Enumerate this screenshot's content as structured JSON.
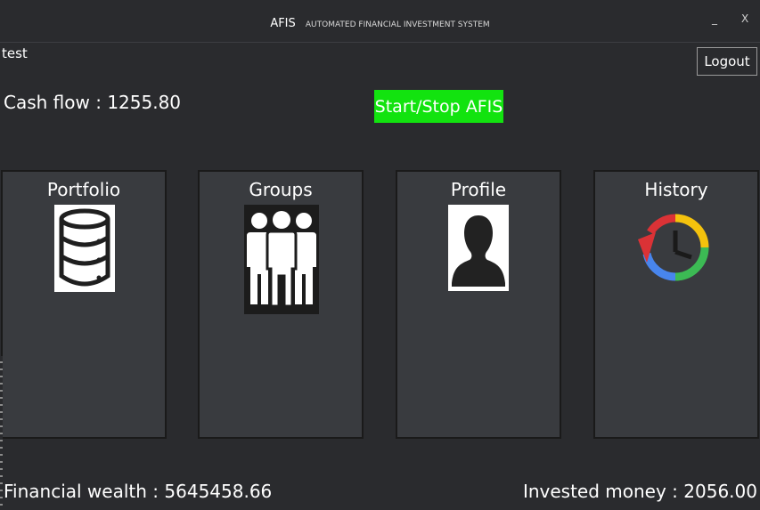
{
  "window": {
    "app_name": "AFIS",
    "app_subtitle": "AUTOMATED FINANCIAL INVESTMENT SYSTEM",
    "minimize": "_",
    "close": "X"
  },
  "user": {
    "name": "test"
  },
  "logout_label": "Logout",
  "cash_flow": {
    "label": "Cash flow :",
    "value": "1255.80"
  },
  "start_stop_label": "Start/Stop AFIS",
  "start_stop_color": "#12e30f",
  "tiles": [
    {
      "label": "Portfolio",
      "icon": "database-icon"
    },
    {
      "label": "Groups",
      "icon": "people-group-icon"
    },
    {
      "label": "Profile",
      "icon": "user-silhouette-icon"
    },
    {
      "label": "History",
      "icon": "history-clock-icon"
    }
  ],
  "financial_wealth": {
    "label": "Financial wealth :",
    "value": "5645458.66"
  },
  "invested_money": {
    "label": "Invested money :",
    "value": "2056.00"
  }
}
